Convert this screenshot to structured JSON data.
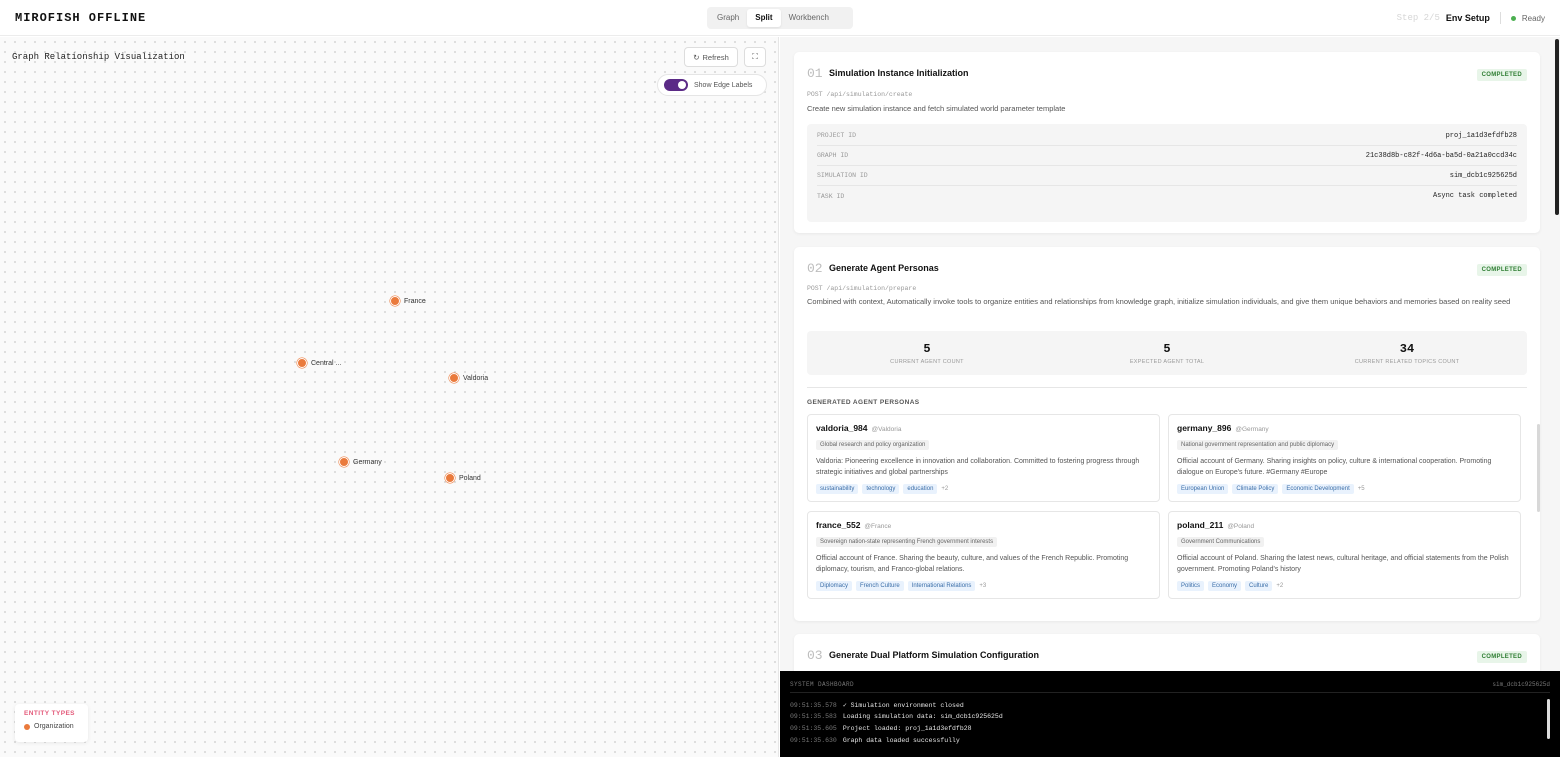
{
  "header": {
    "brand": "MIROFISH OFFLINE",
    "tabs": [
      {
        "label": "Graph"
      },
      {
        "label": "Split"
      },
      {
        "label": "Workbench"
      }
    ],
    "step_label": "Step 2/5",
    "step_name": "Env Setup",
    "status": "Ready",
    "status_color": "#4caf50"
  },
  "graph": {
    "title": "Graph Relationship Visualization",
    "refresh_label": "Refresh",
    "refresh_icon": "refresh-icon",
    "more_icon": "fullscreen-icon",
    "toggle_label": "Show Edge Labels",
    "toggle_on": true,
    "node_color": "#ea7a3c",
    "nodes": [
      {
        "label": "France"
      },
      {
        "label": "Central ..."
      },
      {
        "label": "Valdoria"
      },
      {
        "label": "Germany"
      },
      {
        "label": "Poland"
      }
    ],
    "legend": {
      "title": "ENTITY TYPES",
      "items": [
        {
          "label": "Organization"
        }
      ]
    }
  },
  "workbench": {
    "step1": {
      "num": "01",
      "title": "Simulation Instance Initialization",
      "badge": "COMPLETED",
      "api": "POST /api/simulation/create",
      "desc": "Create new simulation instance and fetch simulated world parameter template",
      "rows": [
        {
          "label": "PROJECT ID",
          "value": "proj_1a1d3efdfb28"
        },
        {
          "label": "GRAPH ID",
          "value": "21c38d8b-c82f-4d6a-ba5d-0a21a0ccd34c"
        },
        {
          "label": "SIMULATION ID",
          "value": "sim_dcb1c925625d"
        },
        {
          "label": "TASK ID",
          "value": "Async task completed"
        }
      ]
    },
    "step2": {
      "num": "02",
      "title": "Generate Agent Personas",
      "badge": "COMPLETED",
      "api": "POST /api/simulation/prepare",
      "desc": "Combined with context, Automatically invoke tools to organize entities and relationships from knowledge graph, initialize simulation individuals, and give them unique behaviors and memories based on reality seed",
      "stats": [
        {
          "value": "5",
          "label": "CURRENT AGENT COUNT"
        },
        {
          "value": "5",
          "label": "EXPECTED AGENT TOTAL"
        },
        {
          "value": "34",
          "label": "CURRENT RELATED TOPICS COUNT"
        }
      ],
      "personas_heading": "GENERATED AGENT PERSONAS",
      "personas": [
        {
          "name": "valdoria_984",
          "handle": "@Valdoria",
          "role": "Global research and policy organization",
          "bio": "Valdoria: Pioneering excellence in innovation and collaboration. Committed to fostering progress through strategic initiatives and global partnerships",
          "tags": [
            "sustainability",
            "technology",
            "education"
          ],
          "more": "+2"
        },
        {
          "name": "germany_896",
          "handle": "@Germany",
          "role": "National government representation and public diplomacy",
          "bio": "Official account of Germany. Sharing insights on policy, culture & international cooperation. Promoting dialogue on Europe's future. #Germany #Europe",
          "tags": [
            "European Union",
            "Climate Policy",
            "Economic Development"
          ],
          "more": "+5"
        },
        {
          "name": "france_552",
          "handle": "@France",
          "role": "Sovereign nation-state representing French government interests",
          "bio": "Official account of France. Sharing the beauty, culture, and values of the French Republic. Promoting diplomacy, tourism, and Franco-global relations.",
          "tags": [
            "Diplomacy",
            "French Culture",
            "International Relations"
          ],
          "more": "+3"
        },
        {
          "name": "poland_211",
          "handle": "@Poland",
          "role": "Government Communications",
          "bio": "Official account of Poland. Sharing the latest news, cultural heritage, and official statements from the Polish government. Promoting Poland's history",
          "tags": [
            "Politics",
            "Economy",
            "Culture"
          ],
          "more": "+2"
        }
      ]
    },
    "step3": {
      "num": "03",
      "title": "Generate Dual Platform Simulation Configuration",
      "badge": "COMPLETED"
    }
  },
  "console": {
    "title": "SYSTEM DASHBOARD",
    "id": "sim_dcb1c925625d",
    "logs": [
      {
        "time": "09:51:35.578",
        "msg": "✓ Simulation environment closed"
      },
      {
        "time": "09:51:35.583",
        "msg": "Loading simulation data: sim_dcb1c925625d"
      },
      {
        "time": "09:51:35.605",
        "msg": "Project loaded: proj_1a1d3efdfb28"
      },
      {
        "time": "09:51:35.630",
        "msg": "Graph data loaded successfully"
      }
    ]
  }
}
